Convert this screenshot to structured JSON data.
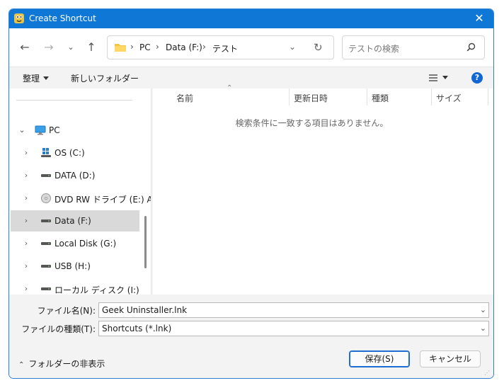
{
  "window": {
    "title": "Create Shortcut"
  },
  "address": {
    "crumbs": [
      "PC",
      "Data (F:)",
      "テスト"
    ]
  },
  "search": {
    "placeholder": "テストの検索"
  },
  "toolbar": {
    "organize": "整理",
    "new_folder": "新しいフォルダー"
  },
  "nav_pane": {
    "items": [
      {
        "label": "PC",
        "icon": "monitor-icon"
      },
      {
        "label": "OS (C:)",
        "icon": "windows-drive-icon"
      },
      {
        "label": "DATA (D:)",
        "icon": "drive-icon"
      },
      {
        "label": "DVD RW ドライブ (E:) Au",
        "icon": "dvd-icon"
      },
      {
        "label": "Data (F:)",
        "icon": "drive-icon",
        "selected": true
      },
      {
        "label": "Local Disk (G:)",
        "icon": "drive-icon"
      },
      {
        "label": "USB (H:)",
        "icon": "drive-icon"
      },
      {
        "label": "ローカル ディスク (I:)",
        "icon": "drive-icon"
      }
    ]
  },
  "file_list": {
    "columns": [
      "名前",
      "更新日時",
      "種類",
      "サイズ"
    ],
    "empty_message": "検索条件に一致する項目はありません。"
  },
  "form": {
    "filename_label": "ファイル名(N):",
    "filename_value": "Geek Uninstaller.lnk",
    "filetype_label": "ファイルの種類(T):",
    "filetype_value": "Shortcuts (*.lnk)"
  },
  "footer": {
    "hide_folders": "フォルダーの非表示",
    "save": "保存(S)",
    "cancel": "キャンセル"
  },
  "colors": {
    "titlebar": "#0f78d6",
    "accent": "#1266d2",
    "selected_row": "#d9d9d9"
  }
}
